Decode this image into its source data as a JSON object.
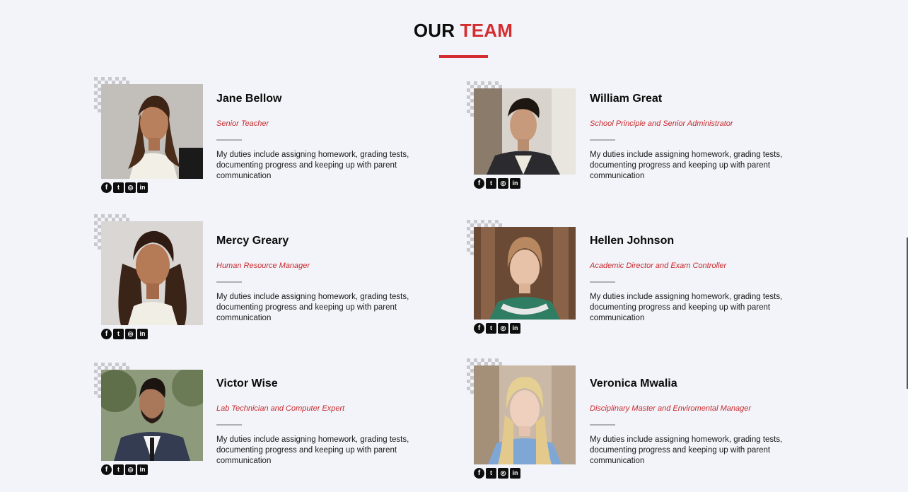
{
  "heading": {
    "word1": "OUR",
    "word2": "TEAM"
  },
  "colors": {
    "accent": "#d42d2f",
    "background": "#f3f4f9"
  },
  "social_icons": [
    "facebook-icon",
    "twitter-icon",
    "instagram-icon",
    "linkedin-icon"
  ],
  "members": [
    {
      "name": "Jane Bellow",
      "role": "Senior Teacher",
      "description": "My duties include assigning homework, grading tests, documenting progress and keeping up with parent communication"
    },
    {
      "name": "William Great",
      "role": "School Principle and Senior Administrator",
      "description": "My duties include assigning homework, grading tests, documenting progress and keeping up with parent communication"
    },
    {
      "name": "Mercy Greary",
      "role": "Human Resource Manager",
      "description": "My duties include assigning homework, grading tests, documenting progress and keeping up with parent communication"
    },
    {
      "name": "Hellen Johnson",
      "role": "Academic Director and Exam Controller",
      "description": "My duties include assigning homework, grading tests, documenting progress and keeping up with parent communication"
    },
    {
      "name": "Victor Wise",
      "role": "Lab Technician and Computer Expert",
      "description": "My duties include assigning homework, grading tests, documenting progress and keeping up with parent communication"
    },
    {
      "name": "Veronica Mwalia",
      "role": "Disciplinary Master and Enviromental Manager",
      "description": "My duties include assigning homework, grading tests, documenting progress and keeping up with parent communication"
    }
  ]
}
